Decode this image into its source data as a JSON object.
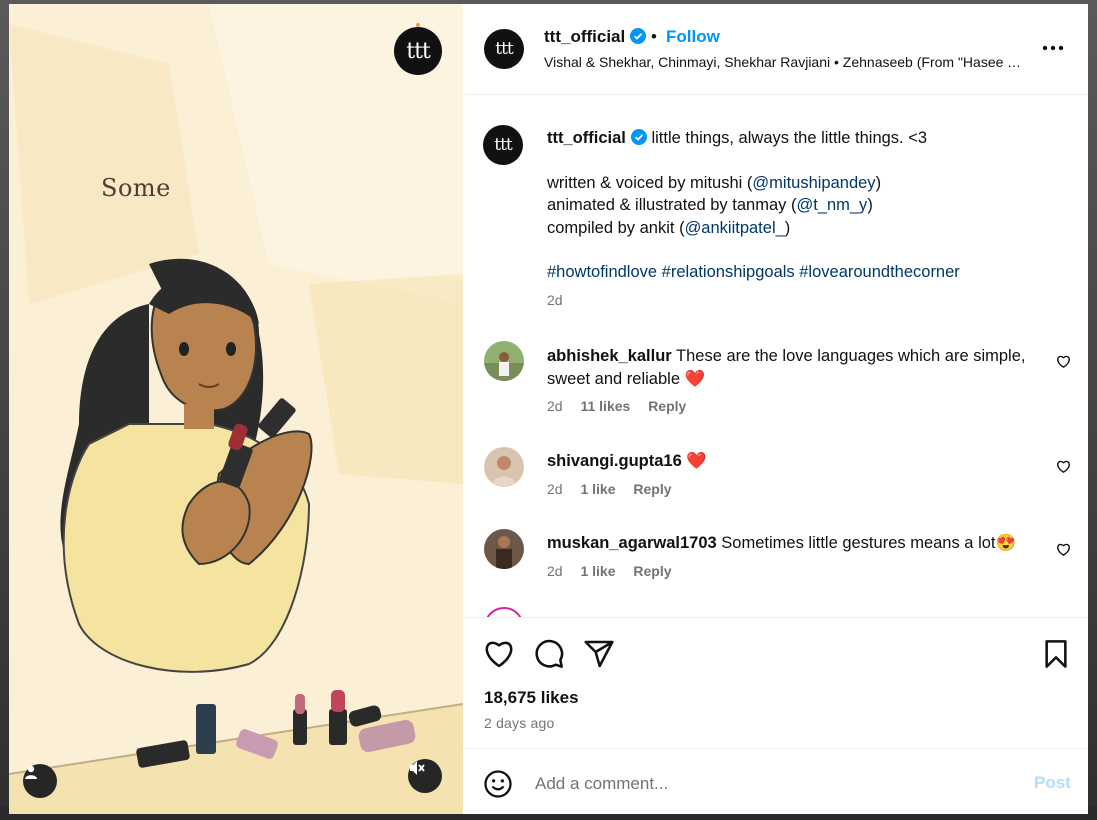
{
  "media": {
    "caption_word": "Some",
    "brand_badge": "ttt",
    "profile_icon": "user-icon",
    "mute_icon": "speaker-muted-icon"
  },
  "header": {
    "avatar_text": "ttt",
    "username": "ttt_official",
    "separator": "•",
    "follow_label": "Follow",
    "audio": "Vishal & Shekhar, Chinmayi, Shekhar Ravjiani • Zehnaseeb (From \"Hasee Toh Phasee\")"
  },
  "caption": {
    "avatar_text": "ttt",
    "username": "ttt_official",
    "text": "little things, always the little things. <3",
    "line1_prefix": "written & voiced by mitushi (",
    "line1_mention": "@mitushipandey",
    "line1_suffix": ")",
    "line2_prefix": "animated & illustrated by tanmay (",
    "line2_mention": "@t_nm_y",
    "line2_suffix": ")",
    "line3_prefix": "compiled by ankit (",
    "line3_mention": "@ankiitpatel_",
    "line3_suffix": ")",
    "hashtags": "#howtofindlove #relationshipgoals #lovearoundthecorner",
    "time": "2d"
  },
  "comments": [
    {
      "username": "abhishek_kallur",
      "text": "These are the love languages which are simple, sweet and reliable ❤️",
      "time": "2d",
      "likes": "11 likes",
      "reply": "Reply"
    },
    {
      "username": "shivangi.gupta16",
      "text": "❤️",
      "time": "2d",
      "likes": "1 like",
      "reply": "Reply"
    },
    {
      "username": "muskan_agarwal1703",
      "text": "Sometimes little gestures means a lot😍",
      "time": "2d",
      "likes": "1 like",
      "reply": "Reply"
    }
  ],
  "actions": {
    "likes": "18,675 likes",
    "posted": "2 days ago"
  },
  "add_comment": {
    "placeholder": "Add a comment...",
    "post_label": "Post"
  },
  "colors": {
    "accent": "#0095f6",
    "mention": "#00376b",
    "muted": "#737373",
    "post_disabled": "#b2dffc",
    "media_bg": "#fbf0d6"
  }
}
